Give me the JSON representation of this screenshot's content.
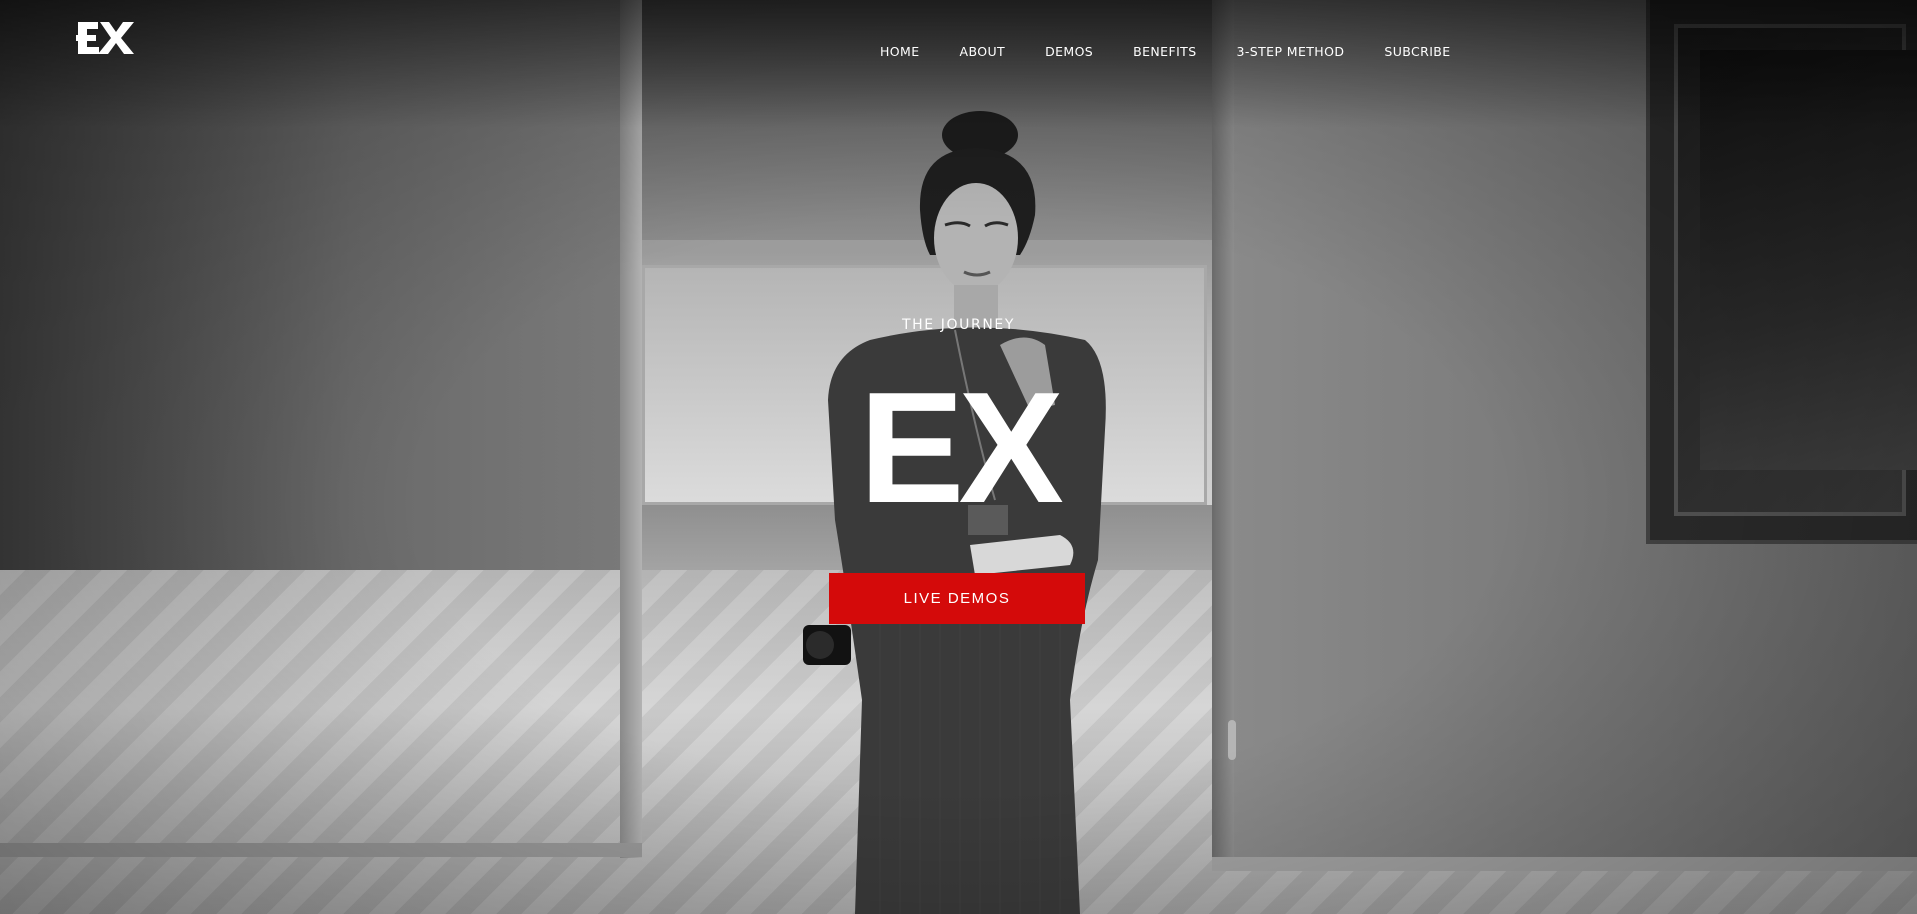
{
  "brand": {
    "logo_text": "EX"
  },
  "nav": {
    "items": [
      {
        "label": "HOME"
      },
      {
        "label": "ABOUT"
      },
      {
        "label": "DEMOS"
      },
      {
        "label": "BENEFITS"
      },
      {
        "label": "3-STEP METHOD"
      },
      {
        "label": "SUBCRIBE"
      }
    ]
  },
  "hero": {
    "subtitle": "THE JOURNEY",
    "title": "EX",
    "cta_label": "LIVE DEMOS"
  },
  "colors": {
    "accent": "#d40a0a",
    "text": "#ffffff"
  },
  "icons": {
    "logo": "ex-logo-icon"
  }
}
